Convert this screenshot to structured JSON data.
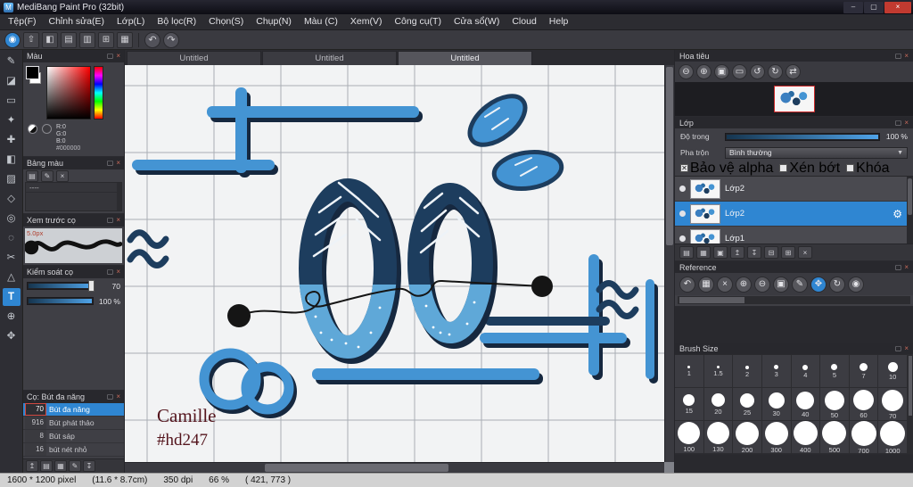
{
  "chrome": {
    "float_glyph": "▢",
    "close_glyph": "×"
  },
  "window": {
    "icon_letter": "M",
    "title": "MediBang Paint Pro (32bit)",
    "minimize_glyph": "–",
    "maximize_glyph": "▢",
    "close_glyph": "×"
  },
  "menubar": {
    "items": [
      "Tệp(F)",
      "Chỉnh sửa(E)",
      "Lớp(L)",
      "Bộ lọc(R)",
      "Chọn(S)",
      "Chụp(N)",
      "Màu (C)",
      "Xem(V)",
      "Công cụ(T)",
      "Cửa sổ(W)",
      "Cloud",
      "Help"
    ]
  },
  "toolbar": {
    "main_buttons": [
      {
        "name": "cloud-brush",
        "glyph": "◉",
        "accent": true
      },
      {
        "name": "upload",
        "glyph": "⇧"
      },
      {
        "name": "comment",
        "glyph": "◧"
      },
      {
        "name": "new-canvas",
        "glyph": "▤"
      },
      {
        "name": "save",
        "glyph": "▥"
      },
      {
        "name": "grid-view",
        "glyph": "⊞"
      },
      {
        "name": "panel-layout",
        "glyph": "▦"
      }
    ],
    "history_buttons": [
      {
        "name": "undo",
        "glyph": "↶"
      },
      {
        "name": "redo",
        "glyph": "↷"
      }
    ]
  },
  "toolbox": {
    "tools": [
      {
        "id": "brush",
        "glyph": "✎"
      },
      {
        "id": "eraser",
        "glyph": "◪"
      },
      {
        "id": "select-rect",
        "glyph": "▭"
      },
      {
        "id": "magic-wand",
        "glyph": "✦"
      },
      {
        "id": "move",
        "glyph": "✚"
      },
      {
        "id": "fill",
        "glyph": "◧"
      },
      {
        "id": "gradient",
        "glyph": "▨"
      },
      {
        "id": "shape",
        "glyph": "◇"
      },
      {
        "id": "eyedropper",
        "glyph": "◎"
      },
      {
        "id": "lasso",
        "glyph": "◌"
      },
      {
        "id": "divide",
        "glyph": "✂"
      },
      {
        "id": "transform",
        "glyph": "△"
      },
      {
        "id": "text",
        "glyph": "T",
        "active": true
      },
      {
        "id": "zoom",
        "glyph": "⊕"
      },
      {
        "id": "hand",
        "glyph": "✥"
      }
    ]
  },
  "left_panels": {
    "color": {
      "title": "Màu",
      "r_label": "R:0",
      "g_label": "G:0",
      "b_label": "B:0",
      "hex": "#000000"
    },
    "palette": {
      "title": "Bảng màu",
      "row_label": "----",
      "buttons": [
        {
          "name": "palette-add",
          "glyph": "▤"
        },
        {
          "name": "palette-edit",
          "glyph": "✎"
        },
        {
          "name": "palette-delete",
          "glyph": "×"
        }
      ]
    },
    "brush_preview": {
      "title": "Xem trước cọ",
      "size_label": "5.0px"
    },
    "brush_control": {
      "title": "Kiểm soát cọ",
      "size_value": "70",
      "opacity_value": "100 %"
    },
    "brush_list": {
      "title": "Cọ: Bút đa năng",
      "items": [
        {
          "size": "70",
          "name": "Bút đa năng",
          "selected": true
        },
        {
          "size": "916",
          "name": "Bút phát thảo"
        },
        {
          "size": "8",
          "name": "Bút sáp"
        },
        {
          "size": "16",
          "name": "bút nét nhỏ"
        }
      ],
      "footer_buttons": [
        {
          "name": "brush-up",
          "glyph": "↥"
        },
        {
          "name": "brush-new",
          "glyph": "▤"
        },
        {
          "name": "brush-folder",
          "glyph": "▦"
        },
        {
          "name": "brush-edit",
          "glyph": "✎"
        },
        {
          "name": "brush-download",
          "glyph": "↧"
        }
      ]
    }
  },
  "documents": {
    "tabs": [
      {
        "label": "Untitled"
      },
      {
        "label": "Untitled"
      },
      {
        "label": "Untitled",
        "active": true
      }
    ]
  },
  "canvas": {
    "signature_line1": "Camille",
    "signature_line2": "#hd247"
  },
  "right_panels": {
    "navigator": {
      "title": "Hoa tiêu",
      "buttons": [
        {
          "name": "zoom-out",
          "glyph": "⊖"
        },
        {
          "name": "zoom-in",
          "glyph": "⊕"
        },
        {
          "name": "fit-window",
          "glyph": "▣"
        },
        {
          "name": "actual-size",
          "glyph": "▭"
        },
        {
          "name": "rotate-left",
          "glyph": "↺"
        },
        {
          "name": "rotate-right",
          "glyph": "↻"
        },
        {
          "name": "reset-view",
          "glyph": "⇄"
        }
      ]
    },
    "layers": {
      "title": "Lớp",
      "opacity_label": "Độ trong",
      "opacity_value": "100 %",
      "blend_label": "Pha trộn",
      "blend_value": "Bình thường",
      "blend_caret": "▼",
      "checkboxes": [
        {
          "label": "Bảo vệ alpha",
          "checked": true
        },
        {
          "label": "Xén bớt",
          "checked": false
        },
        {
          "label": "Khóa",
          "checked": false
        }
      ],
      "items": [
        {
          "name": "Lớp2"
        },
        {
          "name": "Lớp2",
          "selected": true
        },
        {
          "name": "Lớp1"
        }
      ],
      "settings_glyph": "⚙",
      "footer_buttons": [
        {
          "name": "layer-add",
          "glyph": "▤"
        },
        {
          "name": "layer-folder",
          "glyph": "▦"
        },
        {
          "name": "layer-duplicate",
          "glyph": "▣"
        },
        {
          "name": "layer-move-up",
          "glyph": "↥"
        },
        {
          "name": "layer-move-down",
          "glyph": "↧"
        },
        {
          "name": "layer-merge",
          "glyph": "⊟"
        },
        {
          "name": "layer-clear",
          "glyph": "⊞"
        },
        {
          "name": "layer-delete",
          "glyph": "×"
        }
      ]
    },
    "reference": {
      "title": "Reference",
      "buttons": [
        {
          "name": "back",
          "glyph": "↶"
        },
        {
          "name": "open-folder",
          "glyph": "▦"
        },
        {
          "name": "close-image",
          "glyph": "×"
        },
        {
          "name": "zoom-in",
          "glyph": "⊕"
        },
        {
          "name": "zoom-out",
          "glyph": "⊖"
        },
        {
          "name": "fit",
          "glyph": "▣"
        },
        {
          "name": "pick-color",
          "glyph": "✎"
        },
        {
          "name": "hand",
          "glyph": "✥",
          "active": true
        },
        {
          "name": "rotate",
          "glyph": "↻"
        },
        {
          "name": "pin",
          "glyph": "◉"
        }
      ]
    },
    "brush_size": {
      "title": "Brush Size",
      "sizes": [
        "1",
        "1.5",
        "2",
        "3",
        "4",
        "5",
        "7",
        "10",
        "15",
        "20",
        "25",
        "30",
        "40",
        "50",
        "60",
        "70",
        "100",
        "130",
        "200",
        "300",
        "400",
        "500",
        "700",
        "1000"
      ]
    }
  },
  "statusbar": {
    "dimensions": "1600 * 1200 pixel",
    "print_size": "(11.6 * 8.7cm)",
    "dpi": "350 dpi",
    "zoom": "66 %",
    "coords": "( 421, 773 )"
  }
}
